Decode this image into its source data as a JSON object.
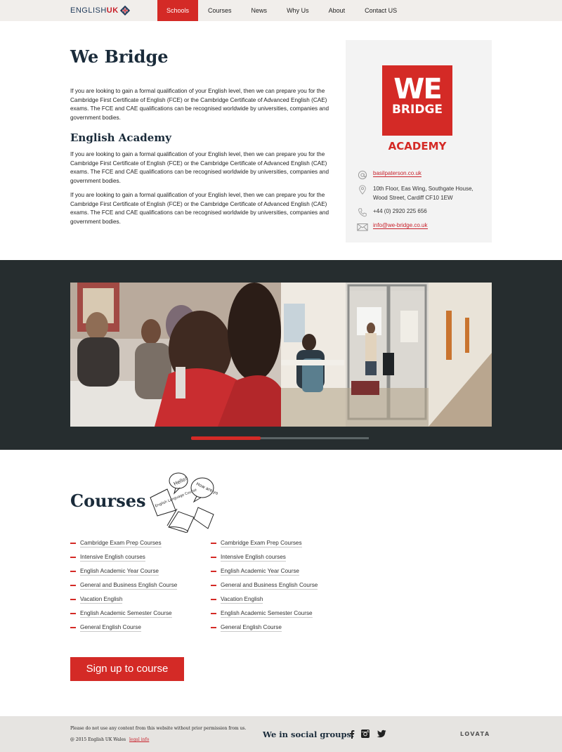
{
  "header": {
    "logo_text_main": "ENGLISH",
    "logo_text_accent": "UK",
    "nav": [
      "Schools",
      "Courses",
      "News",
      "Why Us",
      "About",
      "Contact US"
    ],
    "active_nav": "Schools"
  },
  "intro": {
    "title": "We Bridge",
    "paragraph1": "If you are looking to gain a formal qualification of your English level, then we can prepare you for the Cambridge First Certificate of English (FCE) or the Cambridge Certificate of Advanced English (CAE) exams. The FCE and CAE qualifications can be recognised worldwide by universities, companies and government bodies.",
    "subtitle": "English Academy",
    "paragraph2": "If you are looking to gain a formal qualification of your English level, then we can prepare you for the Cambridge First Certificate of English (FCE) or the Cambridge Certificate of Advanced English (CAE) exams. The FCE and CAE qualifications can be recognised worldwide by universities, companies and government bodies.",
    "paragraph3": "If you are looking to gain a formal qualification of your English level, then we can prepare you for the Cambridge First Certificate of English (FCE) or the Cambridge Certificate of Advanced English (CAE) exams. The FCE and CAE qualifications can be recognised worldwide by universities, companies and government bodies."
  },
  "school_card": {
    "logo_we": "WE",
    "logo_bridge": "BRIDGE",
    "logo_academy": "ACADEMY",
    "website": "basilpaterson.co.uk",
    "address_line1": "10th Floor, Eas Wing, Southgate House,",
    "address_line2": "Wood Street, Cardiff CF10 1EW",
    "phone": "+44 (0) 2920 225 656",
    "email": "info@we-bridge.co.uk"
  },
  "gallery": {
    "progress": 0.39
  },
  "courses": {
    "title": "Courses",
    "doodle_labels": [
      "Hello!",
      "How are you?",
      "English Language Course"
    ],
    "column1": [
      "Cambridge Exam Prep Courses",
      "Intensive English courses",
      "English Academic Year Course",
      "General and Business English Course",
      "Vacation English",
      "English Academic Semester Course",
      "General English Course"
    ],
    "column2": [
      "Cambridge Exam Prep Courses",
      "Intensive English courses",
      "English Academic Year Course",
      "General and Business English Course",
      "Vacation English",
      "English Academic Semester Course",
      "General English Course"
    ],
    "signup_label": "Sign up to course"
  },
  "footer": {
    "notice": "Please do not use any content from this website without prior permission from us.",
    "copyright": "@ 2015 English UK Wales",
    "legal": "legal info",
    "social_label": "We in social groups:",
    "brand": "LOVATA"
  },
  "colors": {
    "accent": "#d42a26",
    "dark_band": "#262d2f",
    "heading": "#1a2b3a",
    "footer_bg": "#e6e4e1"
  }
}
